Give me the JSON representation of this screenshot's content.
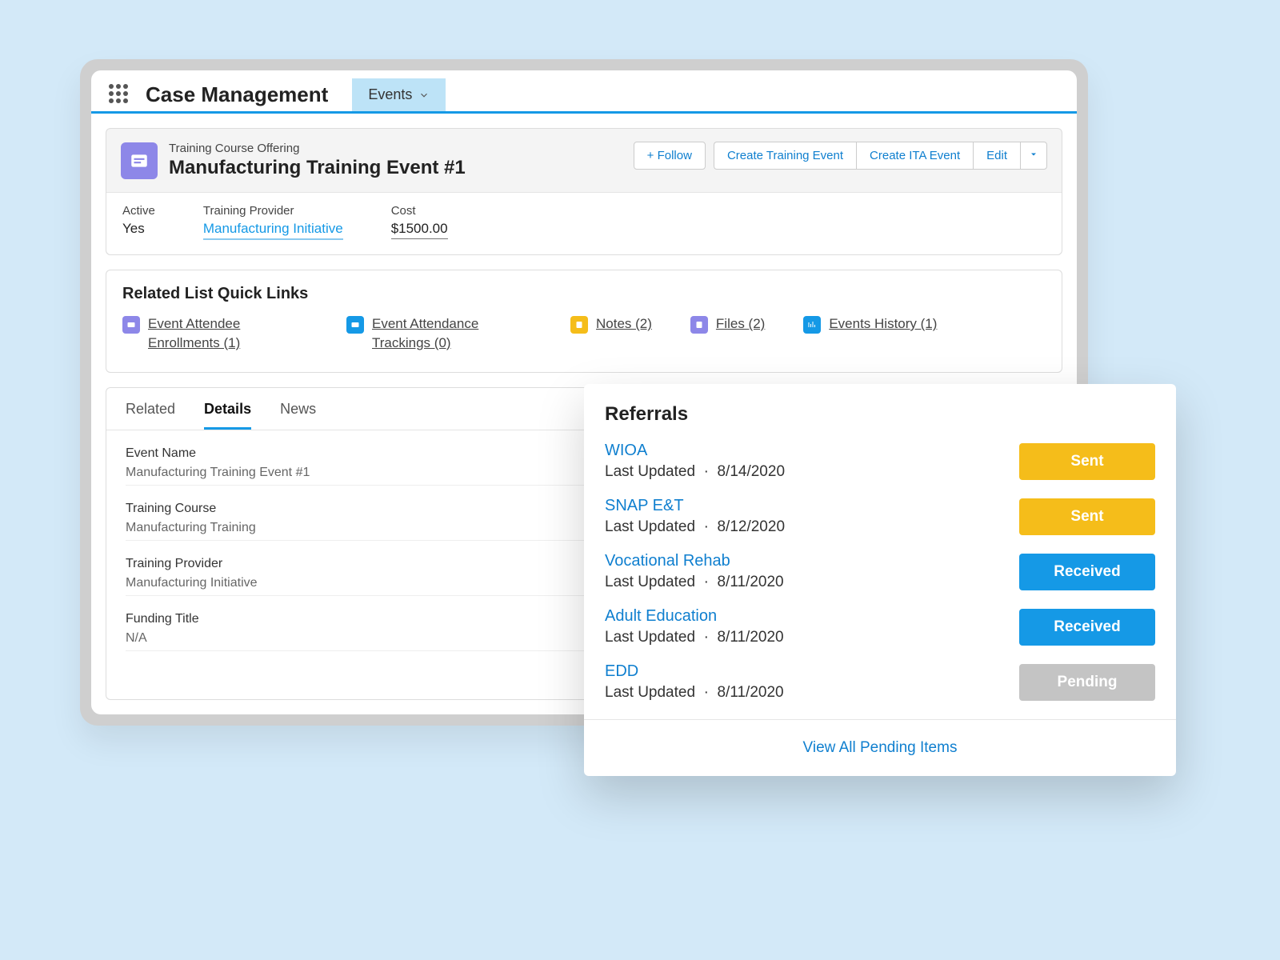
{
  "topbar": {
    "app_title": "Case Management",
    "tab": "Events"
  },
  "record": {
    "type": "Training Course Offering",
    "title": "Manufacturing Training Event #1",
    "actions": {
      "follow": "+ Follow",
      "create_training": "Create Training Event",
      "create_ita": "Create ITA Event",
      "edit": "Edit"
    },
    "fields": [
      {
        "label": "Active",
        "value": "Yes",
        "kind": "plain"
      },
      {
        "label": "Training Provider",
        "value": "Manufacturing Initiative",
        "kind": "link"
      },
      {
        "label": "Cost",
        "value": "$1500.00",
        "kind": "ul"
      }
    ]
  },
  "quick_links": {
    "heading": "Related List Quick Links",
    "items": [
      {
        "label": "Event Attendee Enrollments (1)",
        "color": "purple"
      },
      {
        "label": "Event Attendance Trackings (0)",
        "color": "blue"
      },
      {
        "label": "Notes (2)",
        "color": "yellow"
      },
      {
        "label": "Files (2)",
        "color": "purple"
      },
      {
        "label": "Events History (1)",
        "color": "blue"
      }
    ]
  },
  "tabs": {
    "related": "Related",
    "details": "Details",
    "news": "News",
    "active": "details"
  },
  "details": [
    {
      "label": "Event Name",
      "value": "Manufacturing Training Event #1"
    },
    {
      "label": "Training Course",
      "value": "Manufacturing Training"
    },
    {
      "label": "Training Provider",
      "value": "Manufacturing Initiative"
    },
    {
      "label": "Funding Title",
      "value": "N/A"
    }
  ],
  "referrals": {
    "heading": "Referrals",
    "items": [
      {
        "name": "WIOA",
        "updated_label": "Last Updated",
        "date": "8/14/2020",
        "status": "Sent",
        "status_class": "sent"
      },
      {
        "name": "SNAP E&T",
        "updated_label": "Last Updated",
        "date": "8/12/2020",
        "status": "Sent",
        "status_class": "sent"
      },
      {
        "name": "Vocational Rehab",
        "updated_label": "Last Updated",
        "date": "8/11/2020",
        "status": "Received",
        "status_class": "received"
      },
      {
        "name": "Adult Education",
        "updated_label": "Last Updated",
        "date": "8/11/2020",
        "status": "Received",
        "status_class": "received"
      },
      {
        "name": "EDD",
        "updated_label": "Last Updated",
        "date": "8/11/2020",
        "status": "Pending",
        "status_class": "pending"
      }
    ],
    "footer": "View All Pending Items"
  }
}
